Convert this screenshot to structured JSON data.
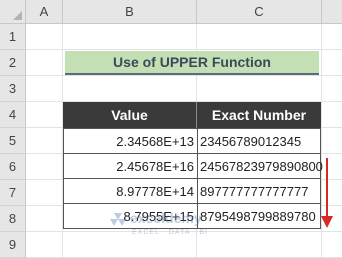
{
  "columns": [
    "A",
    "B",
    "C"
  ],
  "rows": [
    "1",
    "2",
    "3",
    "4",
    "5",
    "6",
    "7",
    "8",
    "9"
  ],
  "title": "Use of UPPER Function",
  "table": {
    "headers": [
      "Value",
      "Exact Number"
    ],
    "rows": [
      {
        "value": "2.34568E+13",
        "exact": "23456789012345"
      },
      {
        "value": "2.45678E+16",
        "exact": "24567823979890800"
      },
      {
        "value": "8.97778E+14",
        "exact": "897777777777777"
      },
      {
        "value": "8.7955E+15",
        "exact": "8795498799889780"
      }
    ]
  },
  "watermark": {
    "brand": "exceldemy",
    "tagline": "EXCEL · DATA · BI"
  },
  "colors": {
    "title_bg": "#c5dfb4",
    "header_bg": "#3a3a3a",
    "arrow": "#d62828"
  },
  "icons": {
    "corner": "select-all-triangle-icon",
    "arrow": "down-arrow-icon"
  }
}
